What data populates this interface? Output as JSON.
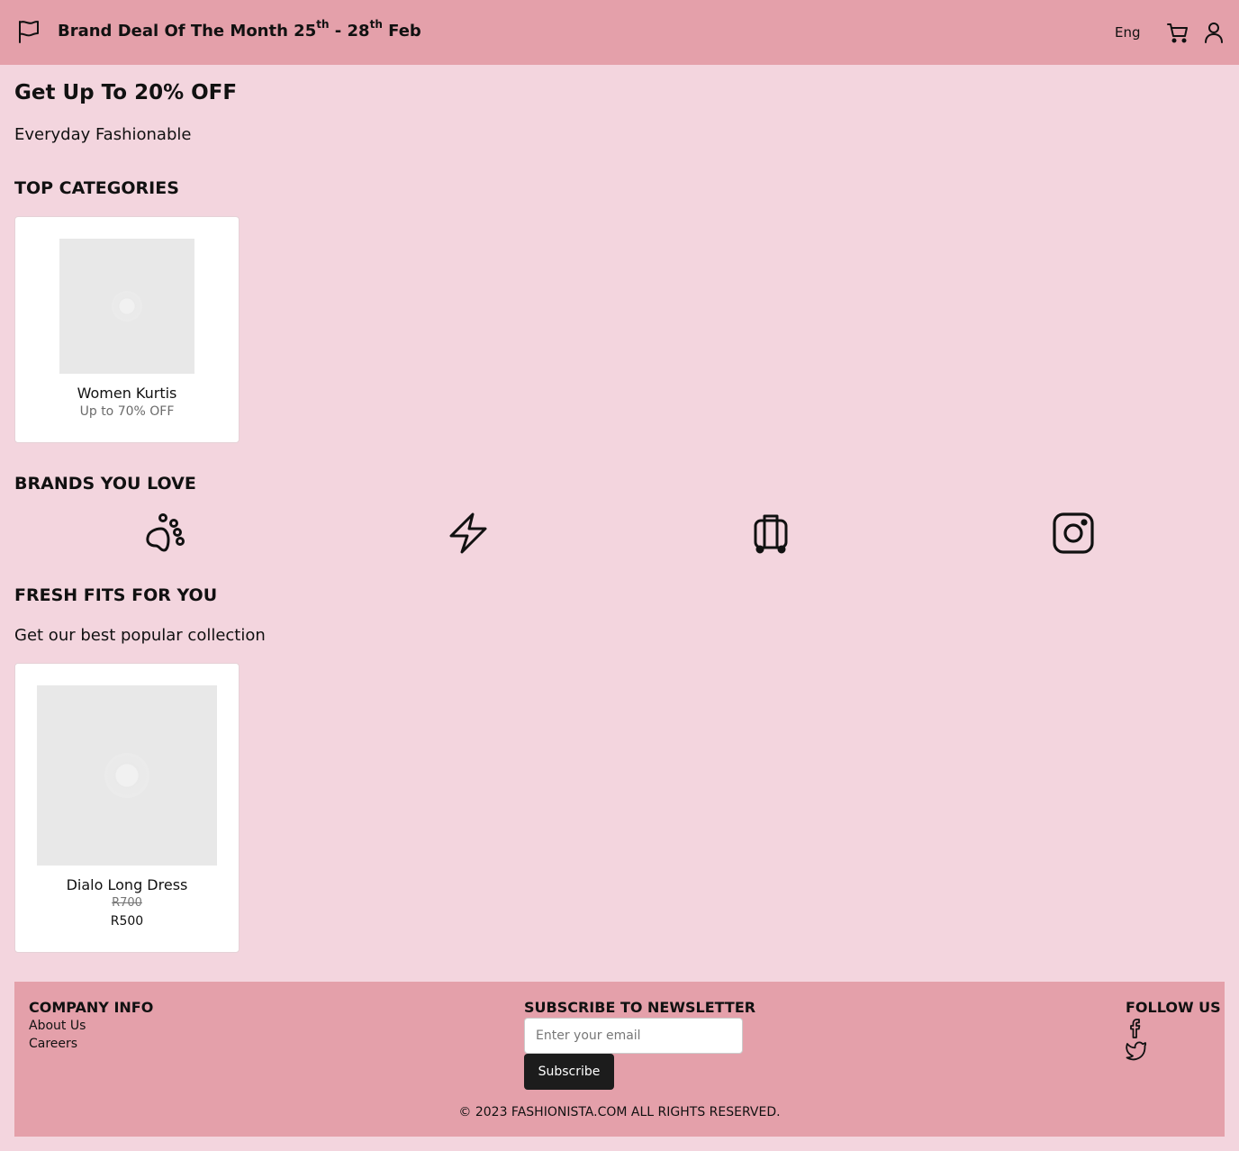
{
  "header": {
    "promo_prefix": "Brand Deal Of The Month 25",
    "promo_sup1": "th",
    "promo_mid": " - 28",
    "promo_sup2": "th",
    "promo_suffix": " Feb",
    "language": "Eng",
    "icons": [
      "flag-icon",
      "cart-icon",
      "user-icon"
    ]
  },
  "hero": {
    "title": "Get Up To 20% OFF",
    "subtitle": "Everyday Fashionable"
  },
  "top_categories": {
    "title": "TOP CATEGORIES",
    "items": [
      {
        "name": "Women Kurtis",
        "offer": "Up to 70% OFF"
      }
    ]
  },
  "brands": {
    "title": "BRANDS YOU LOVE",
    "icons": [
      "paw-icon",
      "bolt-icon",
      "luggage-icon",
      "instagram-icon"
    ]
  },
  "fresh_fits": {
    "title": "FRESH FITS FOR YOU",
    "subtitle": "Get our best popular collection",
    "items": [
      {
        "name": "Dialo Long Dress",
        "old_price": "R700",
        "price": "R500"
      }
    ]
  },
  "footer": {
    "company_title": "COMPANY INFO",
    "links": [
      "About Us",
      "Careers"
    ],
    "newsletter_title": "SUBSCRIBE TO NEWSLETTER",
    "email_placeholder": "Enter your email",
    "subscribe_label": "Subscribe",
    "follow_title": "FOLLOW US",
    "social_icons": [
      "facebook-icon",
      "twitter-icon"
    ],
    "copyright": "© 2023 FASHIONISTA.COM ALL RIGHTS RESERVED."
  },
  "colors": {
    "page_bg": "#f3d5de",
    "bar_bg": "#e4a0aa",
    "button_bg": "#1c1c1c"
  }
}
